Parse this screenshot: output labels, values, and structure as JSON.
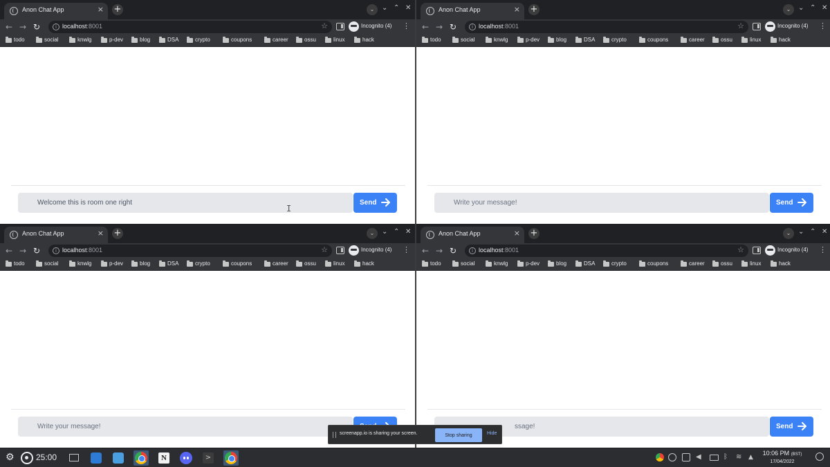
{
  "browser": {
    "tab_title": "Anon Chat App",
    "tab_close": "×",
    "new_tab": "+",
    "url_host": "localhost",
    "url_port": ":8001",
    "star": "☆",
    "incognito_label": "Incognito (4)",
    "menu": "⋮",
    "nav_back": "←",
    "nav_forward": "→",
    "nav_reload": "↻",
    "tab_search": "⌄",
    "win_minimize": "⌄",
    "win_maximize": "⌃",
    "win_close": "✕"
  },
  "bookmarks": [
    "todo",
    "social",
    "knwlg",
    "p-dev",
    "blog",
    "DSA",
    "crypto",
    "coupons",
    "career",
    "ossu",
    "linux",
    "hack"
  ],
  "chat": {
    "placeholder": "Write your message!",
    "send_label": "Send",
    "room_one_typed": "Welcome this is room one right",
    "bottom_right_visible": "ssage!",
    "text_cursor": "I"
  },
  "screen_share": {
    "message": "screenapp.io is sharing your screen.",
    "stop_label": "Stop sharing",
    "hide_label": "Hide"
  },
  "taskbar": {
    "launcher_glyph": "⚙",
    "timer": "25:00",
    "notion_glyph": "N",
    "terminal_glyph": ">",
    "clock_time": "10:06 PM",
    "clock_tz": "(BST)",
    "clock_date": "17/04/2022"
  },
  "colors": {
    "send_button": "#3b82f6",
    "input_bg": "#e5e7eb",
    "chrome_dark": "#202124",
    "toolbar": "#35363a",
    "taskbar": "#2b2d30"
  }
}
